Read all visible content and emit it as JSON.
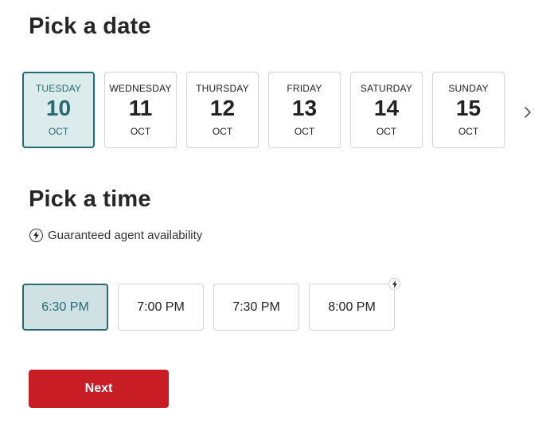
{
  "date_section": {
    "title": "Pick a date",
    "dates": [
      {
        "weekday": "TUESDAY",
        "day": "10",
        "month": "OCT",
        "selected": true
      },
      {
        "weekday": "WEDNESDAY",
        "day": "11",
        "month": "OCT",
        "selected": false
      },
      {
        "weekday": "THURSDAY",
        "day": "12",
        "month": "OCT",
        "selected": false
      },
      {
        "weekday": "FRIDAY",
        "day": "13",
        "month": "OCT",
        "selected": false
      },
      {
        "weekday": "SATURDAY",
        "day": "14",
        "month": "OCT",
        "selected": false
      },
      {
        "weekday": "SUNDAY",
        "day": "15",
        "month": "OCT",
        "selected": false
      }
    ],
    "next_icon": "chevron-right-icon"
  },
  "time_section": {
    "title": "Pick a time",
    "info_icon": "lightning-bolt-icon",
    "info_text": "Guaranteed agent availability",
    "times": [
      {
        "label": "6:30 PM",
        "selected": true,
        "guaranteed": false
      },
      {
        "label": "7:00 PM",
        "selected": false,
        "guaranteed": false
      },
      {
        "label": "7:30 PM",
        "selected": false,
        "guaranteed": false
      },
      {
        "label": "8:00 PM",
        "selected": false,
        "guaranteed": true
      }
    ]
  },
  "actions": {
    "next_label": "Next"
  },
  "colors": {
    "accent": "#256b71",
    "selected_bg": "#dcecec",
    "primary_button": "#c81d25",
    "border": "#d3d3d3"
  }
}
